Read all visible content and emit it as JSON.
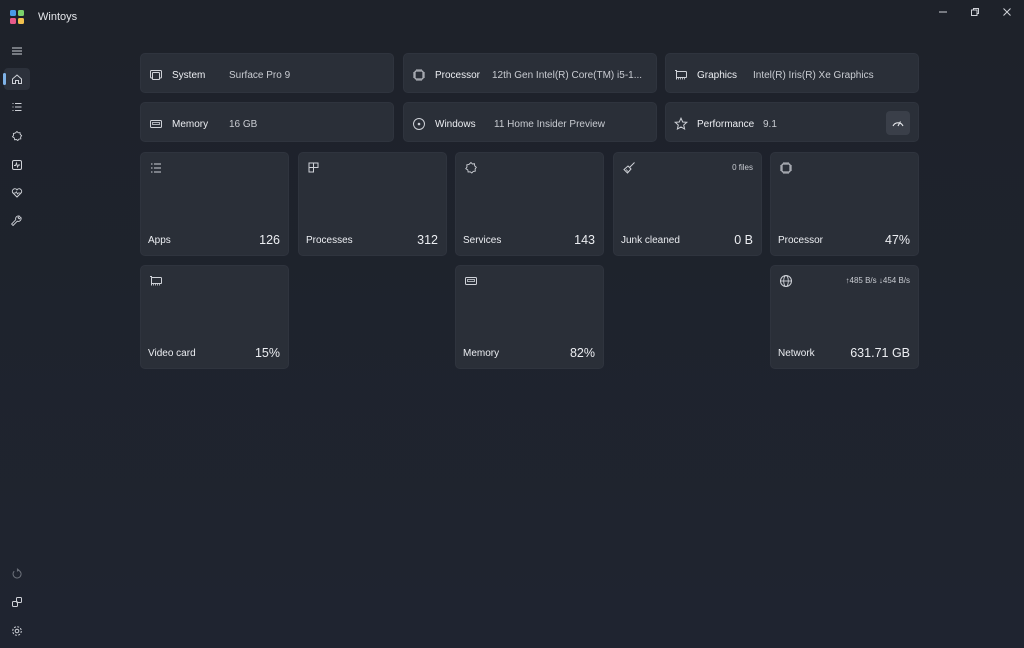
{
  "window": {
    "title": "Wintoys",
    "logo_colors": [
      "#4a9be8",
      "#7ad16a",
      "#e85a8a",
      "#f2c14e"
    ]
  },
  "sidebar": {
    "items": [
      {
        "icon": "hamburger-menu-icon"
      },
      {
        "icon": "home-icon",
        "active": true
      },
      {
        "icon": "apps-list-icon"
      },
      {
        "icon": "services-gear-icon"
      },
      {
        "icon": "health-monitor-icon"
      },
      {
        "icon": "heart-pulse-icon"
      },
      {
        "icon": "wrench-icon"
      }
    ],
    "bottom_items": [
      {
        "icon": "refresh-icon"
      },
      {
        "icon": "integrations-icon"
      },
      {
        "icon": "settings-icon"
      }
    ]
  },
  "info": {
    "system": {
      "label": "System",
      "value": "Surface Pro 9"
    },
    "processor": {
      "label": "Processor",
      "value": "12th Gen Intel(R) Core(TM) i5-1..."
    },
    "graphics": {
      "label": "Graphics",
      "value": "Intel(R) Iris(R) Xe Graphics"
    },
    "memory": {
      "label": "Memory",
      "value": "16 GB"
    },
    "windows": {
      "label": "Windows",
      "value": "11 Home Insider Preview"
    },
    "performance": {
      "label": "Performance",
      "value": "9.1"
    }
  },
  "tiles": {
    "apps": {
      "label": "Apps",
      "value": "126"
    },
    "processes": {
      "label": "Processes",
      "value": "312"
    },
    "services": {
      "label": "Services",
      "value": "143"
    },
    "junk": {
      "label": "Junk cleaned",
      "value": "0 B",
      "extra": "0 files"
    },
    "processor": {
      "label": "Processor",
      "value": "47%"
    },
    "video": {
      "label": "Video card",
      "value": "15%"
    },
    "memory": {
      "label": "Memory",
      "value": "82%"
    },
    "network": {
      "label": "Network",
      "value": "631.71 GB",
      "extra": "↑485 B/s ↓454 B/s"
    }
  }
}
